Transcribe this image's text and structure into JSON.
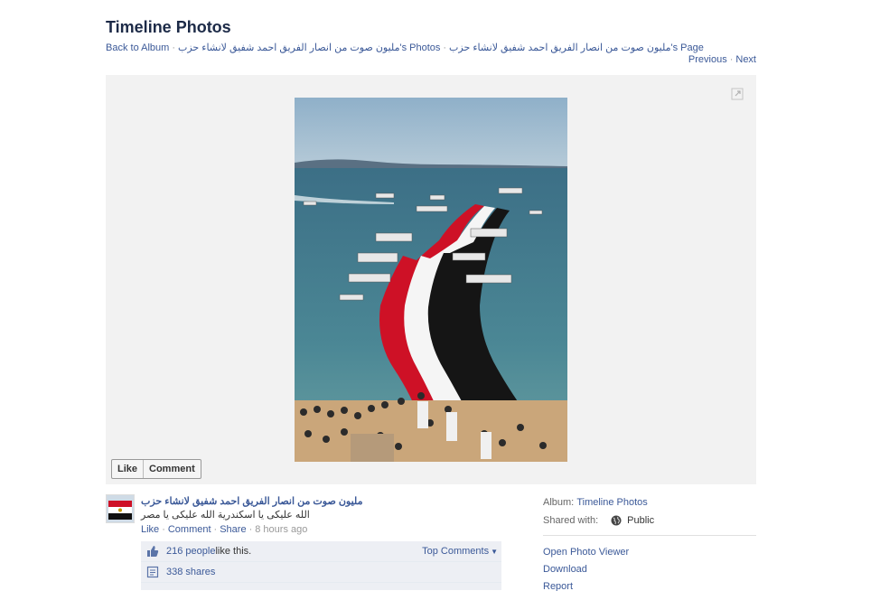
{
  "page": {
    "title": "Timeline Photos"
  },
  "breadcrumb": {
    "back": "Back to Album",
    "album": "مليون صوت من انصار الفريق احمد شفيق لانشاء حزب's Photos",
    "page": "مليون صوت من انصار الفريق احمد شفيق لانشاء حزب's Page"
  },
  "pager": {
    "previous": "Previous",
    "next": "Next"
  },
  "photo_actions": {
    "like": "Like",
    "comment": "Comment"
  },
  "post": {
    "author": "مليون صوت من انصار الفريق احمد شفيق لانشاء حزب",
    "caption": "الله عليكى يا اسكندرية الله عليكى يا مصر",
    "like": "Like",
    "comment": "Comment",
    "share": "Share",
    "time": "8 hours ago"
  },
  "ufi": {
    "likes_link": "216 people",
    "likes_text": " like this.",
    "top_comments": "Top Comments",
    "shares": "338 shares"
  },
  "side": {
    "album_label": "Album:",
    "album_value": "Timeline Photos",
    "shared_label": "Shared with:",
    "shared_value": "Public",
    "options": [
      "Open Photo Viewer",
      "Download",
      "Report"
    ]
  },
  "colors": {
    "link": "#3b5998",
    "flag_red": "#ce1126",
    "flag_white": "#ffffff",
    "flag_black": "#000000",
    "stage_bg": "#f2f2f2"
  },
  "icons": [
    "expand-icon",
    "thumbs-up-icon",
    "shares-icon",
    "globe-icon"
  ]
}
